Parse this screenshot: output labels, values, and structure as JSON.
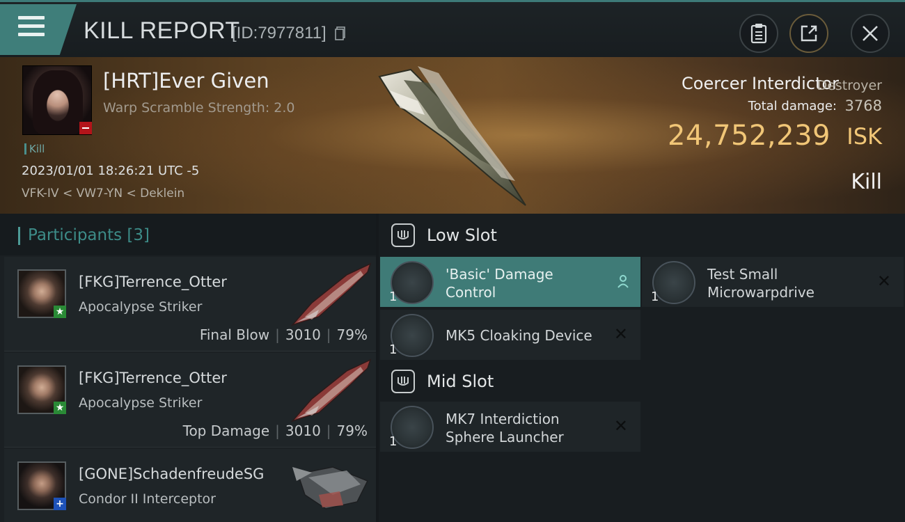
{
  "header": {
    "title": "KILL REPORT",
    "report_id": "[ID:7977811]"
  },
  "victim": {
    "name": "[HRT]Ever Given",
    "warp_scramble": "Warp Scramble Strength: 2.0",
    "type": "Kill",
    "timestamp": "2023/01/01 18:26:21 UTC -5",
    "location": "VFK-IV < VW7-YN < Deklein",
    "ship_name": "Coercer Interdictor",
    "ship_class": "Destroyer",
    "total_damage_label": "Total damage:",
    "total_damage": "3768",
    "isk_value": "24,752,239",
    "isk_unit": "ISK",
    "result": "Kill"
  },
  "participants": {
    "title": "Participants",
    "count": "[3]",
    "items": [
      {
        "name": "[FKG]Terrence_Otter",
        "ship": "Apocalypse Striker",
        "role": "Final Blow",
        "damage": "3010",
        "percent": "79%",
        "badge": "★"
      },
      {
        "name": "[FKG]Terrence_Otter",
        "ship": "Apocalypse Striker",
        "role": "Top Damage",
        "damage": "3010",
        "percent": "79%",
        "badge": "★"
      },
      {
        "name": "[GONE]SchadenfreudeSG",
        "ship": "Condor II Interceptor",
        "badge": "+"
      }
    ]
  },
  "fitting": {
    "low_slot": {
      "title": "Low Slot",
      "modules": [
        {
          "line1": "'Basic' Damage",
          "line2": "Control",
          "qty": "1"
        },
        {
          "line1": "Test Small",
          "line2": "Microwarpdrive",
          "qty": "1",
          "close": "✕"
        },
        {
          "line1": "MK5 Cloaking Device",
          "line2": "",
          "qty": "1",
          "close": "✕"
        }
      ]
    },
    "mid_slot": {
      "title": "Mid Slot",
      "modules": [
        {
          "line1": "MK7 Interdiction",
          "line2": "Sphere Launcher",
          "qty": "1",
          "close": "✕"
        }
      ]
    }
  }
}
